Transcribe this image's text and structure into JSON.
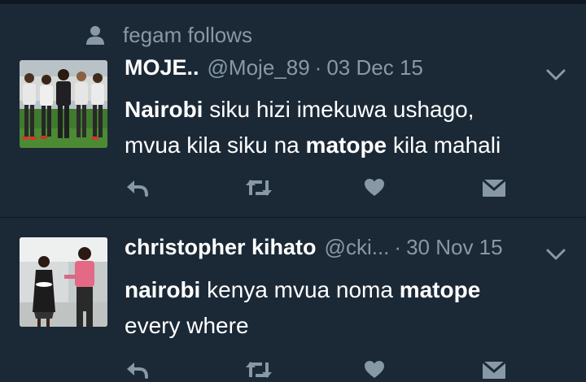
{
  "colors": {
    "background": "#1b2836",
    "divider": "#0f1822",
    "muted": "#8899a6",
    "text": "#ffffff"
  },
  "tweets": [
    {
      "social_context": "fegam follows",
      "name": "MOJE..",
      "handle": "@Moje_89",
      "separator": "·",
      "date": "03 Dec 15",
      "body": [
        {
          "text": "Nairobi",
          "bold": true
        },
        {
          "text": " siku hizi imekuwa ushago,",
          "bold": false
        },
        {
          "text": "\n",
          "bold": false
        },
        {
          "text": "mvua kila siku na ",
          "bold": false
        },
        {
          "text": "matope",
          "bold": true
        },
        {
          "text": " kila mahali",
          "bold": false
        }
      ],
      "actions": [
        "reply-icon",
        "retweet-icon",
        "like-icon",
        "direct-message-icon"
      ]
    },
    {
      "social_context": "",
      "name": "christopher kihato",
      "handle": "@cki...",
      "separator": "·",
      "date": "30 Nov 15",
      "body": [
        {
          "text": "nairobi",
          "bold": true
        },
        {
          "text": " kenya mvua noma ",
          "bold": false
        },
        {
          "text": "matope",
          "bold": true
        },
        {
          "text": "\n",
          "bold": false
        },
        {
          "text": "every where",
          "bold": false
        }
      ],
      "actions": [
        "reply-icon",
        "retweet-icon",
        "like-icon",
        "direct-message-icon"
      ]
    }
  ]
}
